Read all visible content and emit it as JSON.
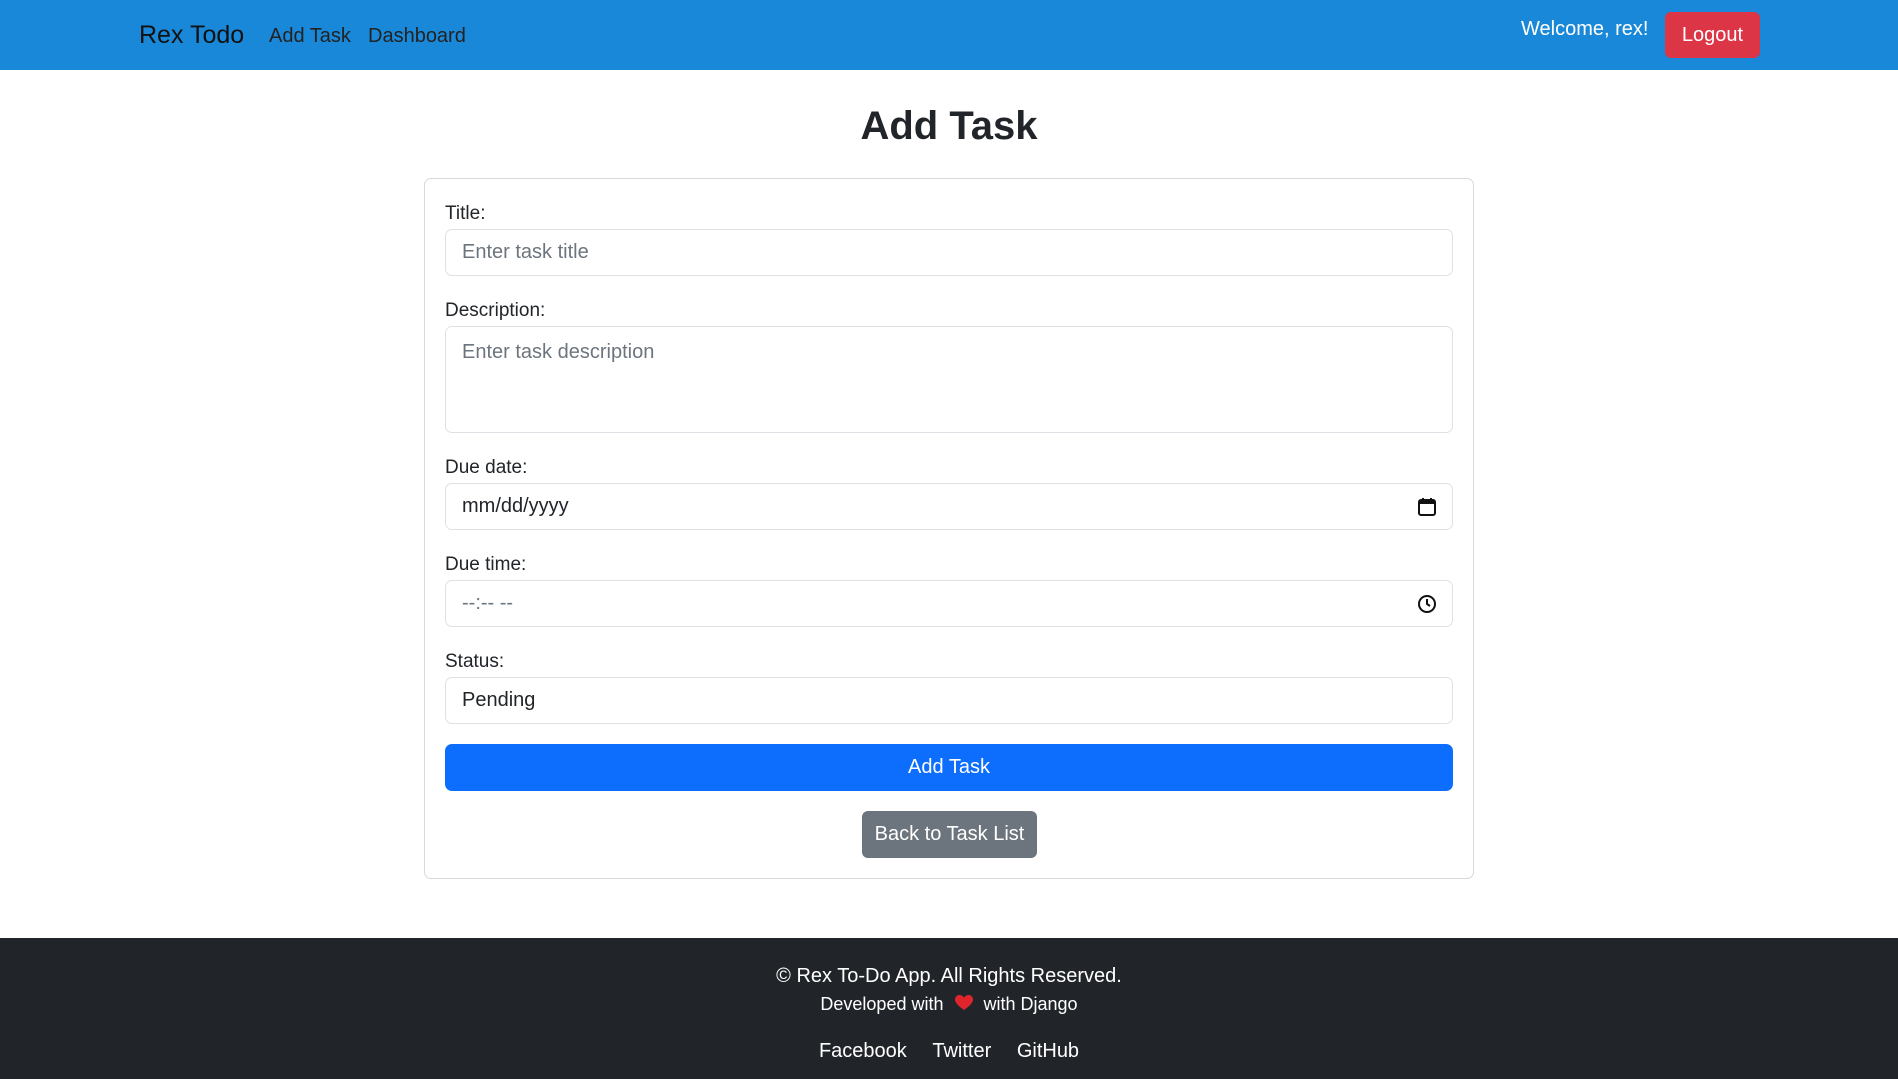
{
  "nav": {
    "brand": "Rex Todo",
    "links": [
      "Add Task",
      "Dashboard"
    ],
    "welcome": "Welcome, rex!",
    "logout": "Logout"
  },
  "page": {
    "title": "Add Task"
  },
  "form": {
    "title_label": "Title:",
    "title_placeholder": "Enter task title",
    "description_label": "Description:",
    "description_placeholder": "Enter task description",
    "due_date_label": "Due date:",
    "due_date_value": "mm/dd/yyyy",
    "due_time_label": "Due time:",
    "due_time_value": "--:-- --",
    "status_label": "Status:",
    "status_value": "Pending",
    "submit_label": "Add Task",
    "back_label": "Back to Task List"
  },
  "footer": {
    "copyright": "© Rex To-Do App. All Rights Reserved.",
    "developed_prefix": "Developed with",
    "developed_suffix": "with Django",
    "links": [
      "Facebook",
      "Twitter",
      "GitHub"
    ]
  },
  "colors": {
    "navbar": "#1a88d9",
    "primary": "#0d6efd",
    "danger": "#dc3545",
    "secondary": "#6c757d",
    "footer": "#212529",
    "heart": "#e0242b"
  },
  "icons": {
    "date": "calendar-icon",
    "time": "clock-icon",
    "heart": "heart-icon"
  }
}
